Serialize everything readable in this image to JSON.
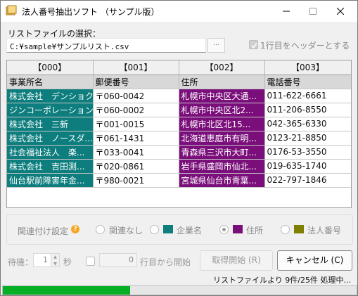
{
  "window": {
    "title": "法人番号抽出ソフト （サンプル版）",
    "minimize_icon": "minimize-icon",
    "maximize_icon": "maximize-icon",
    "close_icon": "close-icon"
  },
  "source": {
    "label": "リストファイルの選択：",
    "path": "C:¥sample¥サンプルリスト.csv",
    "browse_label": "...",
    "header_checkbox_label": "1行目をヘッダーとする",
    "header_checkbox_checked": true
  },
  "grid": {
    "column_ids": [
      "【000】",
      "【001】",
      "【002】",
      "【003】"
    ],
    "column_names": [
      "事業所名",
      "郵便番号",
      "住所",
      "電話番号"
    ],
    "rows": [
      [
        "株式会社　デンショク",
        "〒060-0042",
        "札幌市中央区大通...",
        "011-622-6661"
      ],
      [
        "ジンコーポレーション...",
        "〒060-0002",
        "札幌市中央区北2...",
        "011-206-8550"
      ],
      [
        "株式会社　三新",
        "〒001-0015",
        "札幌市北区北15...",
        "042-365-6330"
      ],
      [
        "株式会社　ノースダ...",
        "〒061-1431",
        "北海道恵庭市有明...",
        "0123-21-8850"
      ],
      [
        "社会福祉法人　楽...",
        "〒033-0041",
        "青森県三沢市大町...",
        "0176-53-3550"
      ],
      [
        "株式会社　吉田測...",
        "〒020-0861",
        "岩手県盛岡市仙北...",
        "019-635-1740"
      ],
      [
        "仙台駅前障害年金...",
        "〒980-0021",
        "宮城県仙台市青葉...",
        "022-797-1846"
      ]
    ],
    "highlight_colors": {
      "company": "#0d7d7d",
      "address": "#7a0e7a",
      "corporate_number": "#808000"
    }
  },
  "mapping": {
    "label": "関連付け設定",
    "help_icon": "help-icon",
    "options": [
      {
        "label": "関連なし",
        "color": null,
        "checked": false
      },
      {
        "label": "企業名",
        "color": "#0d7d7d",
        "checked": false
      },
      {
        "label": "住所",
        "color": "#7a0e7a",
        "checked": true
      },
      {
        "label": "法人番号",
        "color": "#808000",
        "checked": false
      }
    ]
  },
  "controls": {
    "wait_label": "待機：",
    "wait_value": "1",
    "seconds_label": "秒",
    "start_row_value": "0",
    "start_row_label": "行目から開始",
    "fetch_button": "取得開始 (R)",
    "cancel_button": "キャンセル (C)"
  },
  "status": {
    "text": "リストファイルより 9件/25件 処理中...",
    "progress_fraction": 0.36,
    "progress_color": "#06b025"
  }
}
